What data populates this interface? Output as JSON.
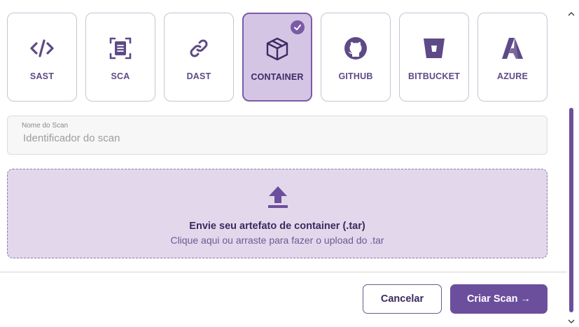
{
  "scan_types": [
    {
      "label": "SAST",
      "icon": "code-icon",
      "selected": false
    },
    {
      "label": "SCA",
      "icon": "document-scan-icon",
      "selected": false
    },
    {
      "label": "DAST",
      "icon": "link-icon",
      "selected": false
    },
    {
      "label": "CONTAINER",
      "icon": "box-icon",
      "selected": true
    },
    {
      "label": "GITHUB",
      "icon": "github-icon",
      "selected": false
    },
    {
      "label": "BITBUCKET",
      "icon": "bitbucket-icon",
      "selected": false
    },
    {
      "label": "AZURE",
      "icon": "azure-icon",
      "selected": false
    }
  ],
  "scan_name": {
    "label": "Nome do Scan",
    "value": "",
    "placeholder": "Identificador do scan"
  },
  "upload": {
    "title": "Envie seu artefato de container (.tar)",
    "subtitle": "Clique aqui ou arraste para fazer o upload do .tar",
    "icon": "upload-icon"
  },
  "actions": {
    "cancel_label": "Cancelar",
    "create_label": "Criar Scan →"
  },
  "colors": {
    "accent": "#6c4f9c",
    "selected_bg": "#d4c5e5",
    "dropzone_bg": "#e3d7ec"
  }
}
